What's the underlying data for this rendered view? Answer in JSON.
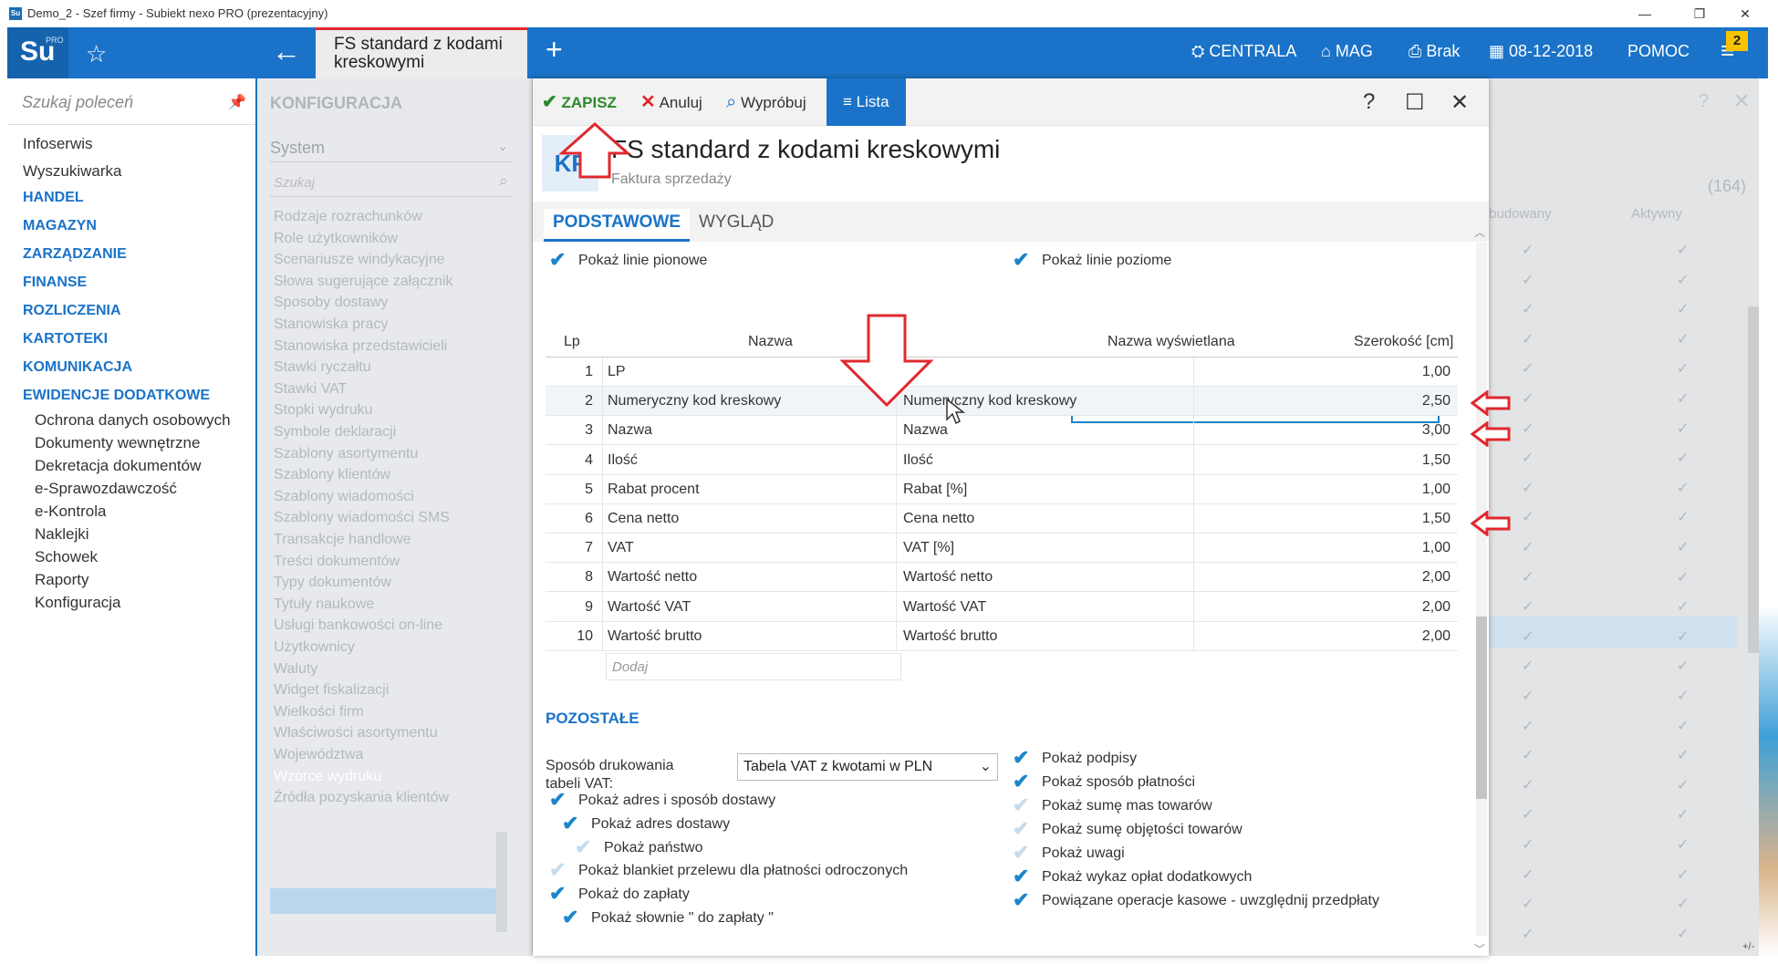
{
  "window": {
    "title": "Demo_2 - Szef firmy - Subiekt nexo PRO (prezentacyjny)",
    "icon": "Su",
    "controls": [
      "—",
      "❐",
      "✕"
    ]
  },
  "appbar": {
    "logo": "Su",
    "logo_badge": "PRO",
    "active_tab": "FS standard z kodami kreskowymi",
    "menu": {
      "centrala": "CENTRALA",
      "mag": "MAG",
      "brak": "Brak",
      "date": "08-12-2018",
      "pomoc": "POMOC"
    },
    "notification_count": "2"
  },
  "leftnav": {
    "search_placeholder": "Szukaj poleceń",
    "plain_items": [
      "Infoserwis",
      "Wyszukiwarka"
    ],
    "headers": [
      "HANDEL",
      "MAGAZYN",
      "ZARZĄDZANIE",
      "FINANSE",
      "ROZLICZENIA",
      "KARTOTEKI",
      "KOMUNIKACJA",
      "EWIDENCJE DODATKOWE"
    ],
    "sub_items": [
      "Ochrona danych osobowych",
      "Dokumenty wewnętrzne",
      "Dekretacja dokumentów",
      "e-Sprawozdawczość",
      "e-Kontrola",
      "Naklejki",
      "Schowek",
      "Raporty",
      "Konfiguracja"
    ]
  },
  "config": {
    "header": "KONFIGURACJA",
    "select": "System",
    "search_placeholder": "Szukaj",
    "items": [
      "Rodzaje rozrachunków",
      "Role użytkowników",
      "Scenariusze windykacyjne",
      "Słowa sugerujące załącznik",
      "Sposoby dostawy",
      "Stanowiska pracy",
      "Stanowiska przedstawicieli",
      "Stawki ryczałtu",
      "Stawki VAT",
      "Stopki wydruku",
      "Symbole deklaracji",
      "Szablony asortymentu",
      "Szablony klientów",
      "Szablony wiadomości",
      "Szablony wiadomości SMS",
      "Transakcje handlowe",
      "Treści dokumentów",
      "Typy dokumentów",
      "Tytuły naukowe",
      "Usługi bankowości on-line",
      "Użytkownicy",
      "Waluty",
      "Widget fiskalizacji",
      "Wielkości firm",
      "Właściwości asortymentu",
      "Województwa",
      "Wzorce wydruku",
      "Źródła pozyskania klientów"
    ],
    "selected_index": 26
  },
  "background_grid": {
    "count": "(164)",
    "col1": "Wbudowany",
    "col2": "Aktywny"
  },
  "dialog": {
    "toolbar": {
      "save": "ZAPISZ",
      "cancel": "Anuluj",
      "try": "Wypróbuj",
      "list": "Lista"
    },
    "badge": "KF",
    "title": "FS standard z kodami kreskowymi",
    "subtitle": "Faktura sprzedaży",
    "tabs": [
      "PODSTAWOWE",
      "WYGLĄD"
    ],
    "top_options": [
      {
        "label": "Pokaż linie pionowe",
        "checked": true
      },
      {
        "label": "Pokaż linie poziome",
        "checked": true
      }
    ],
    "grid": {
      "headers": [
        "Lp",
        "Nazwa",
        "Nazwa wyświetlana",
        "Szerokość [cm]"
      ],
      "rows": [
        {
          "lp": "1",
          "name": "LP",
          "display": "LP",
          "width": "1,00"
        },
        {
          "lp": "2",
          "name": "Numeryczny kod kreskowy",
          "display": "Numeryczny kod kreskowy",
          "width": "2,50"
        },
        {
          "lp": "3",
          "name": "Nazwa",
          "display": "Nazwa",
          "width": "3,00"
        },
        {
          "lp": "4",
          "name": "Ilość",
          "display": "Ilość",
          "width": "1,50"
        },
        {
          "lp": "5",
          "name": "Rabat procent",
          "display": "Rabat [%]",
          "width": "1,00"
        },
        {
          "lp": "6",
          "name": "Cena netto",
          "display": "Cena netto",
          "width": "1,50"
        },
        {
          "lp": "7",
          "name": "VAT",
          "display": "VAT [%]",
          "width": "1,00"
        },
        {
          "lp": "8",
          "name": "Wartość netto",
          "display": "Wartość netto",
          "width": "2,00"
        },
        {
          "lp": "9",
          "name": "Wartość VAT",
          "display": "Wartość VAT",
          "width": "2,00"
        },
        {
          "lp": "10",
          "name": "Wartość brutto",
          "display": "Wartość brutto",
          "width": "2,00"
        }
      ],
      "add_placeholder": "Dodaj"
    },
    "other_section": "POZOSTAŁE",
    "vat_label": "Sposób drukowania tabeli VAT:",
    "vat_value": "Tabela VAT z kwotami w PLN",
    "left_options": [
      {
        "label": "Pokaż adres i sposób dostawy",
        "checked": true,
        "indent": 0
      },
      {
        "label": "Pokaż adres dostawy",
        "checked": true,
        "indent": 1
      },
      {
        "label": "Pokaż państwo",
        "checked": false,
        "indent": 2
      },
      {
        "label": "Pokaż blankiet przelewu dla płatności odroczonych",
        "checked": false,
        "indent": 0
      },
      {
        "label": "Pokaż do zapłaty",
        "checked": true,
        "indent": 0
      },
      {
        "label": "Pokaż słownie \" do zapłaty \"",
        "checked": true,
        "indent": 1
      }
    ],
    "right_options": [
      {
        "label": "Pokaż podpisy",
        "checked": true
      },
      {
        "label": "Pokaż sposób płatności",
        "checked": true
      },
      {
        "label": "Pokaż sumę mas towarów",
        "checked": false
      },
      {
        "label": "Pokaż sumę objętości towarów",
        "checked": false
      },
      {
        "label": "Pokaż uwagi",
        "checked": false
      },
      {
        "label": "Pokaż wykaz opłat dodatkowych",
        "checked": true
      },
      {
        "label": "Powiązane operacje kasowe - uwzględnij przedpłaty",
        "checked": true
      }
    ]
  },
  "corner_text": "+/-",
  "colors": {
    "brand_blue": "#1a73c8",
    "check_blue": "#1a86c8",
    "annotation_red": "#e0282e",
    "save_green": "#2a8a2a"
  }
}
